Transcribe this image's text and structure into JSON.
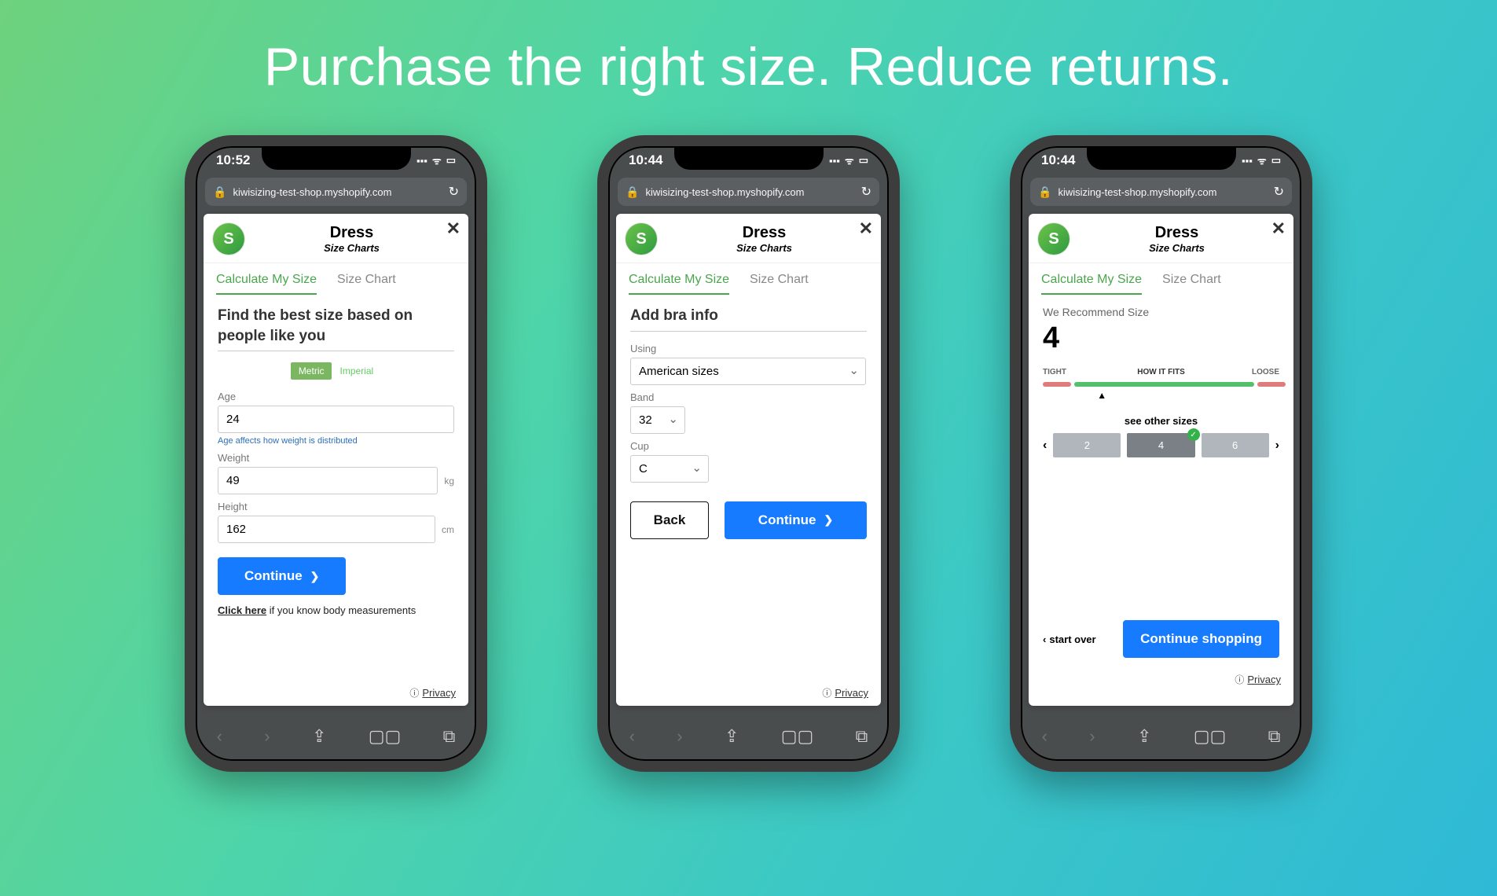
{
  "headline": "Purchase the right size. Reduce returns.",
  "address_bar": "kiwisizing-test-shop.myshopify.com",
  "phone1": {
    "time": "10:52",
    "title": "Dress",
    "subtitle": "Size Charts",
    "tab_calc": "Calculate My Size",
    "tab_chart": "Size Chart",
    "heading": "Find the best size based on people like you",
    "unit_metric": "Metric",
    "unit_imperial": "Imperial",
    "age_label": "Age",
    "age_value": "24",
    "age_hint": "Age affects how weight is distributed",
    "weight_label": "Weight",
    "weight_value": "49",
    "weight_unit": "kg",
    "height_label": "Height",
    "height_value": "162",
    "height_unit": "cm",
    "continue": "Continue",
    "note_click": "Click here",
    "note_rest": " if you know body measurements",
    "privacy": "Privacy"
  },
  "phone2": {
    "time": "10:44",
    "title": "Dress",
    "subtitle": "Size Charts",
    "tab_calc": "Calculate My Size",
    "tab_chart": "Size Chart",
    "heading": "Add bra info",
    "using_label": "Using",
    "using_value": "American sizes",
    "band_label": "Band",
    "band_value": "32",
    "cup_label": "Cup",
    "cup_value": "C",
    "back": "Back",
    "continue": "Continue",
    "privacy": "Privacy"
  },
  "phone3": {
    "time": "10:44",
    "title": "Dress",
    "subtitle": "Size Charts",
    "tab_calc": "Calculate My Size",
    "tab_chart": "Size Chart",
    "recline": "We Recommend Size",
    "recsize": "4",
    "tight": "TIGHT",
    "howfits": "HOW IT FITS",
    "loose": "LOOSE",
    "seeother": "see other sizes",
    "sizes": [
      "2",
      "4",
      "6"
    ],
    "startover": "start over",
    "continue_shopping": "Continue shopping",
    "privacy": "Privacy"
  }
}
